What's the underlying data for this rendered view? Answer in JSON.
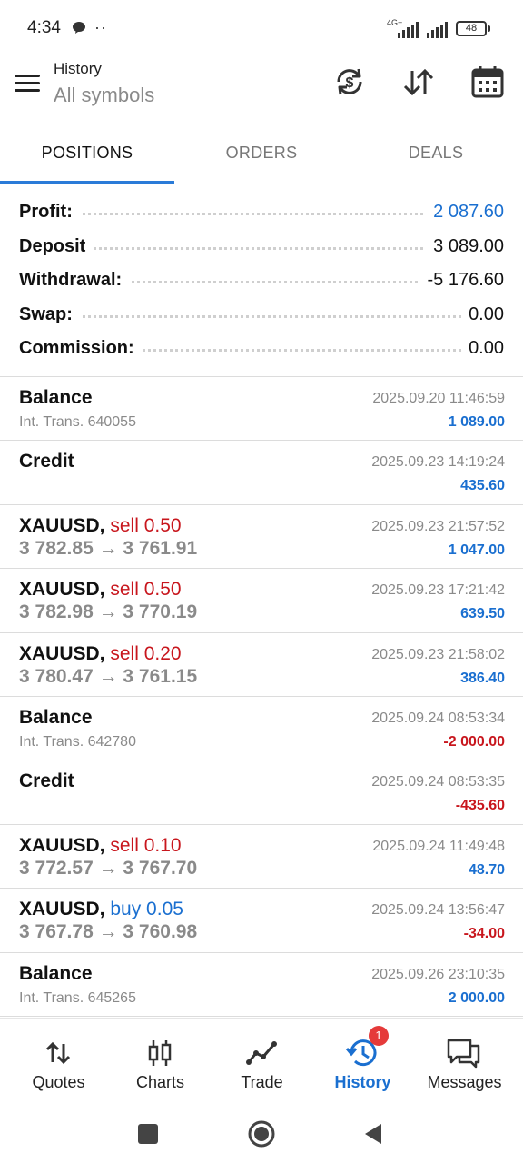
{
  "status_bar": {
    "time": "4:34",
    "dots": "··",
    "network": "4G+",
    "battery": "48"
  },
  "toolbar": {
    "title": "History",
    "subtitle": "All symbols",
    "icons": [
      "currency-exchange-icon",
      "sort-icon",
      "calendar-icon"
    ]
  },
  "tabs": [
    {
      "label": "POSITIONS",
      "active": true
    },
    {
      "label": "ORDERS",
      "active": false
    },
    {
      "label": "DEALS",
      "active": false
    }
  ],
  "summary": [
    {
      "label": "Profit:",
      "value": "2 087.60"
    },
    {
      "label": "Deposit",
      "value": "3 089.00"
    },
    {
      "label": "Withdrawal:",
      "value": "-5 176.60"
    },
    {
      "label": "Swap:",
      "value": "0.00"
    },
    {
      "label": "Commission:",
      "value": "0.00"
    }
  ],
  "records": [
    {
      "title": "Balance",
      "sub": "Int. Trans. 640055",
      "time": "2025.09.20 11:46:59",
      "amount": "1 089.00"
    },
    {
      "title": "Credit",
      "time": "2025.09.23 14:19:24",
      "amount": "435.60"
    },
    {
      "symbol": "XAUUSD,",
      "side": "sell 0.50",
      "prices": "3 782.85 → 3 761.91",
      "time": "2025.09.23 21:57:52",
      "amount": "1 047.00"
    },
    {
      "symbol": "XAUUSD,",
      "side": "sell 0.50",
      "prices": "3 782.98 → 3 770.19",
      "time": "2025.09.23 17:21:42",
      "amount": "639.50"
    },
    {
      "symbol": "XAUUSD,",
      "side": "sell 0.20",
      "prices": "3 780.47 → 3 761.15",
      "time": "2025.09.23 21:58:02",
      "amount": "386.40"
    },
    {
      "title": "Balance",
      "sub": "Int. Trans. 642780",
      "time": "2025.09.24 08:53:34",
      "amount": "-2 000.00"
    },
    {
      "title": "Credit",
      "time": "2025.09.24 08:53:35",
      "amount": "-435.60"
    },
    {
      "symbol": "XAUUSD,",
      "side": "sell 0.10",
      "prices": "3 772.57 → 3 767.70",
      "time": "2025.09.24 11:49:48",
      "amount": "48.70"
    },
    {
      "symbol": "XAUUSD,",
      "side": "buy 0.05",
      "prices": "3 767.78 → 3 760.98",
      "time": "2025.09.24 13:56:47",
      "amount": "-34.00"
    },
    {
      "title": "Balance",
      "sub": "Int. Trans. 645265",
      "time": "2025.09.26 23:10:35",
      "amount": "2 000.00"
    }
  ],
  "bottom_nav": [
    {
      "label": "Quotes",
      "icon": "quotes-arrows-icon"
    },
    {
      "label": "Charts",
      "icon": "candlestick-icon"
    },
    {
      "label": "Trade",
      "icon": "trade-line-icon"
    },
    {
      "label": "History",
      "icon": "history-clock-icon",
      "active": true
    },
    {
      "label": "Messages",
      "icon": "chat-icon",
      "badge": "1"
    }
  ],
  "colors": {
    "accent": "#1a6fd0",
    "sell": "#c8161d",
    "muted": "#8a8a8a"
  }
}
